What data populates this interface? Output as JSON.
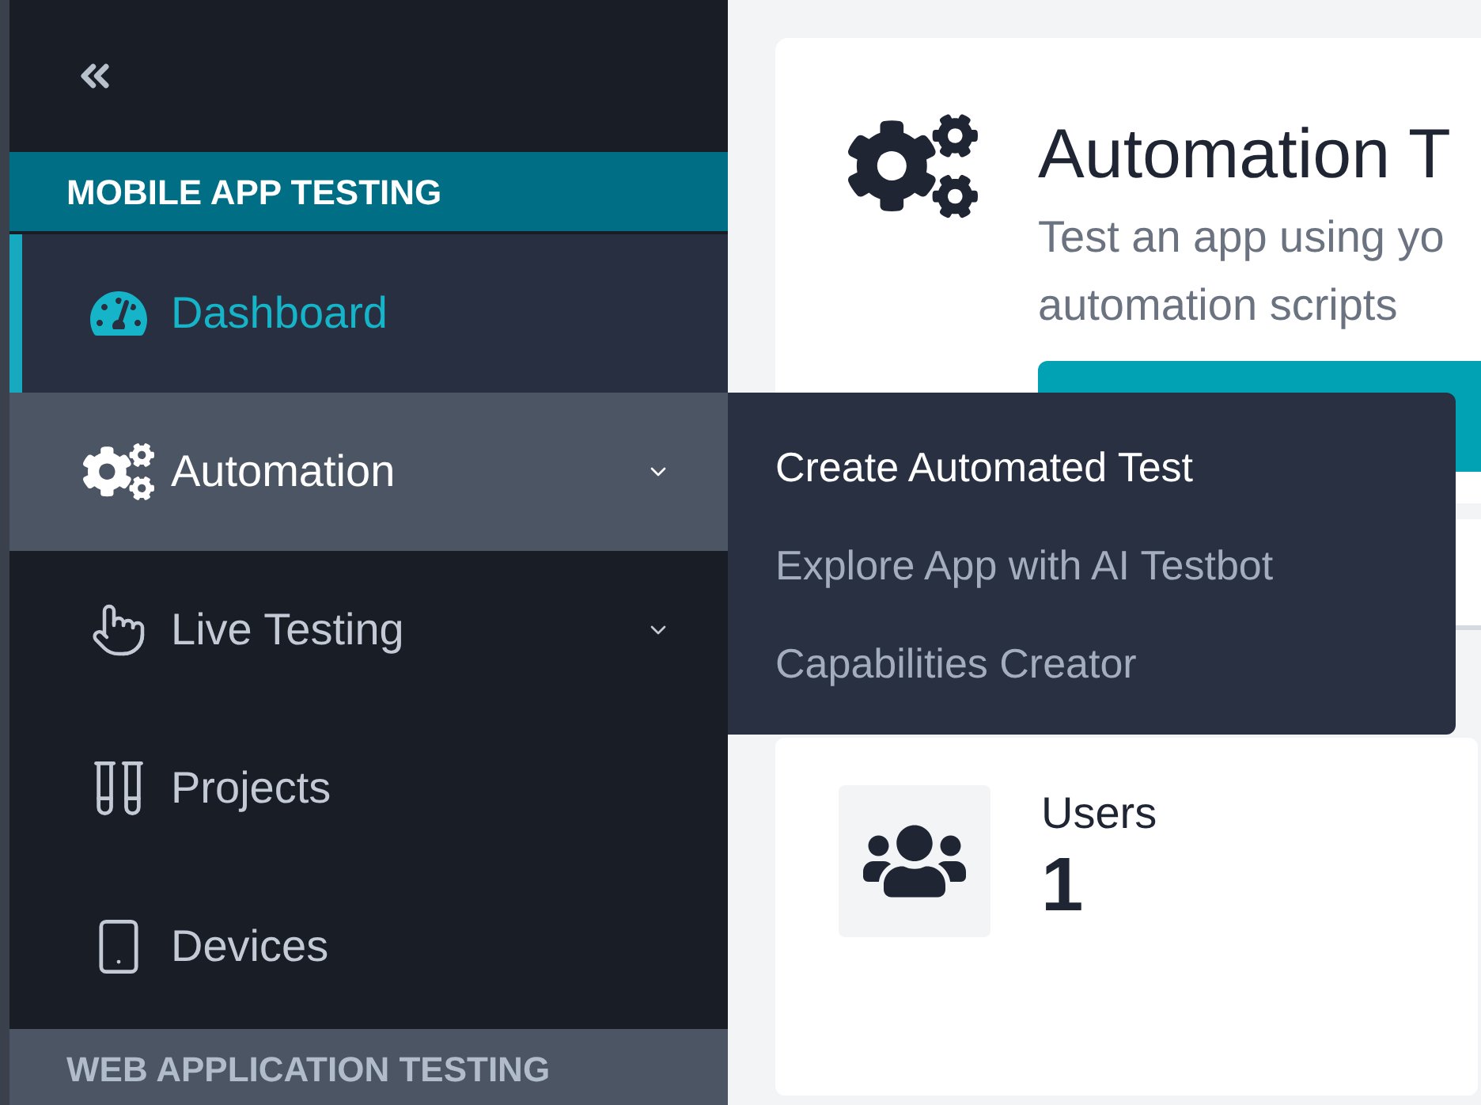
{
  "sidebar": {
    "sections": [
      {
        "title": "MOBILE APP TESTING",
        "selected": true,
        "items": [
          {
            "label": "Dashboard",
            "kind": "link",
            "selected": true
          },
          {
            "label": "Automation",
            "kind": "group",
            "selected": false,
            "expanded": true
          },
          {
            "label": "Live Testing",
            "kind": "group",
            "selected": false,
            "expanded": false
          },
          {
            "label": "Projects",
            "kind": "link",
            "selected": false
          },
          {
            "label": "Devices",
            "kind": "link",
            "selected": false
          }
        ]
      },
      {
        "title": "WEB APPLICATION TESTING",
        "selected": false
      }
    ]
  },
  "submenu": {
    "items": [
      {
        "label": "Create Automated Test",
        "selected": true
      },
      {
        "label": "Explore App with AI Testbot",
        "selected": false
      },
      {
        "label": "Capabilities Creator",
        "selected": false
      }
    ]
  },
  "hero_card": {
    "title": "Automation T",
    "description_lines": [
      "Test an app using yo",
      "automation scripts"
    ]
  },
  "stat_card": {
    "label": "Users",
    "value": "1"
  }
}
